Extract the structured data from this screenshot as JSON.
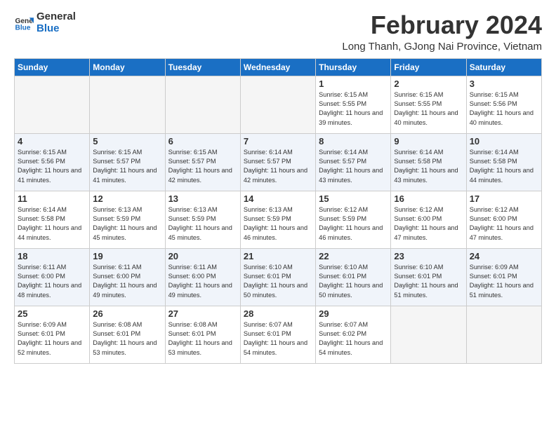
{
  "app": {
    "name_line1": "General",
    "name_line2": "Blue"
  },
  "calendar": {
    "title": "February 2024",
    "subtitle": "Long Thanh, GJong Nai Province, Vietnam",
    "days_of_week": [
      "Sunday",
      "Monday",
      "Tuesday",
      "Wednesday",
      "Thursday",
      "Friday",
      "Saturday"
    ],
    "weeks": [
      [
        {
          "date": "",
          "sunrise": "",
          "sunset": "",
          "daylight": ""
        },
        {
          "date": "",
          "sunrise": "",
          "sunset": "",
          "daylight": ""
        },
        {
          "date": "",
          "sunrise": "",
          "sunset": "",
          "daylight": ""
        },
        {
          "date": "",
          "sunrise": "",
          "sunset": "",
          "daylight": ""
        },
        {
          "date": "1",
          "sunrise": "6:15 AM",
          "sunset": "5:55 PM",
          "daylight": "11 hours and 39 minutes."
        },
        {
          "date": "2",
          "sunrise": "6:15 AM",
          "sunset": "5:55 PM",
          "daylight": "11 hours and 40 minutes."
        },
        {
          "date": "3",
          "sunrise": "6:15 AM",
          "sunset": "5:56 PM",
          "daylight": "11 hours and 40 minutes."
        }
      ],
      [
        {
          "date": "4",
          "sunrise": "6:15 AM",
          "sunset": "5:56 PM",
          "daylight": "11 hours and 41 minutes."
        },
        {
          "date": "5",
          "sunrise": "6:15 AM",
          "sunset": "5:57 PM",
          "daylight": "11 hours and 41 minutes."
        },
        {
          "date": "6",
          "sunrise": "6:15 AM",
          "sunset": "5:57 PM",
          "daylight": "11 hours and 42 minutes."
        },
        {
          "date": "7",
          "sunrise": "6:14 AM",
          "sunset": "5:57 PM",
          "daylight": "11 hours and 42 minutes."
        },
        {
          "date": "8",
          "sunrise": "6:14 AM",
          "sunset": "5:57 PM",
          "daylight": "11 hours and 43 minutes."
        },
        {
          "date": "9",
          "sunrise": "6:14 AM",
          "sunset": "5:58 PM",
          "daylight": "11 hours and 43 minutes."
        },
        {
          "date": "10",
          "sunrise": "6:14 AM",
          "sunset": "5:58 PM",
          "daylight": "11 hours and 44 minutes."
        }
      ],
      [
        {
          "date": "11",
          "sunrise": "6:14 AM",
          "sunset": "5:58 PM",
          "daylight": "11 hours and 44 minutes."
        },
        {
          "date": "12",
          "sunrise": "6:13 AM",
          "sunset": "5:59 PM",
          "daylight": "11 hours and 45 minutes."
        },
        {
          "date": "13",
          "sunrise": "6:13 AM",
          "sunset": "5:59 PM",
          "daylight": "11 hours and 45 minutes."
        },
        {
          "date": "14",
          "sunrise": "6:13 AM",
          "sunset": "5:59 PM",
          "daylight": "11 hours and 46 minutes."
        },
        {
          "date": "15",
          "sunrise": "6:12 AM",
          "sunset": "5:59 PM",
          "daylight": "11 hours and 46 minutes."
        },
        {
          "date": "16",
          "sunrise": "6:12 AM",
          "sunset": "6:00 PM",
          "daylight": "11 hours and 47 minutes."
        },
        {
          "date": "17",
          "sunrise": "6:12 AM",
          "sunset": "6:00 PM",
          "daylight": "11 hours and 47 minutes."
        }
      ],
      [
        {
          "date": "18",
          "sunrise": "6:11 AM",
          "sunset": "6:00 PM",
          "daylight": "11 hours and 48 minutes."
        },
        {
          "date": "19",
          "sunrise": "6:11 AM",
          "sunset": "6:00 PM",
          "daylight": "11 hours and 49 minutes."
        },
        {
          "date": "20",
          "sunrise": "6:11 AM",
          "sunset": "6:00 PM",
          "daylight": "11 hours and 49 minutes."
        },
        {
          "date": "21",
          "sunrise": "6:10 AM",
          "sunset": "6:01 PM",
          "daylight": "11 hours and 50 minutes."
        },
        {
          "date": "22",
          "sunrise": "6:10 AM",
          "sunset": "6:01 PM",
          "daylight": "11 hours and 50 minutes."
        },
        {
          "date": "23",
          "sunrise": "6:10 AM",
          "sunset": "6:01 PM",
          "daylight": "11 hours and 51 minutes."
        },
        {
          "date": "24",
          "sunrise": "6:09 AM",
          "sunset": "6:01 PM",
          "daylight": "11 hours and 51 minutes."
        }
      ],
      [
        {
          "date": "25",
          "sunrise": "6:09 AM",
          "sunset": "6:01 PM",
          "daylight": "11 hours and 52 minutes."
        },
        {
          "date": "26",
          "sunrise": "6:08 AM",
          "sunset": "6:01 PM",
          "daylight": "11 hours and 53 minutes."
        },
        {
          "date": "27",
          "sunrise": "6:08 AM",
          "sunset": "6:01 PM",
          "daylight": "11 hours and 53 minutes."
        },
        {
          "date": "28",
          "sunrise": "6:07 AM",
          "sunset": "6:01 PM",
          "daylight": "11 hours and 54 minutes."
        },
        {
          "date": "29",
          "sunrise": "6:07 AM",
          "sunset": "6:02 PM",
          "daylight": "11 hours and 54 minutes."
        },
        {
          "date": "",
          "sunrise": "",
          "sunset": "",
          "daylight": ""
        },
        {
          "date": "",
          "sunrise": "",
          "sunset": "",
          "daylight": ""
        }
      ]
    ]
  }
}
